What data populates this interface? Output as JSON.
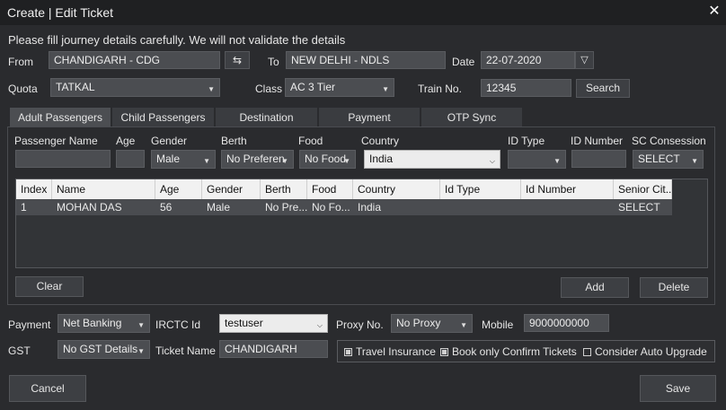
{
  "window": {
    "title": "Create | Edit Ticket"
  },
  "intro": "Please fill journey details carefully. We will not validate the details",
  "journey": {
    "from_label": "From",
    "from_value": "CHANDIGARH - CDG",
    "swap_icon": "⇆",
    "to_label": "To",
    "to_value": "NEW DELHI - NDLS",
    "date_label": "Date",
    "date_value": "22-07-2020",
    "quota_label": "Quota",
    "quota_value": "TATKAL",
    "class_label": "Class",
    "class_value": "AC 3 Tier",
    "train_label": "Train No.",
    "train_value": "12345",
    "search_label": "Search"
  },
  "tabs": [
    {
      "label": "Adult Passengers",
      "active": true
    },
    {
      "label": "Child Passengers"
    },
    {
      "label": "Destination"
    },
    {
      "label": "Payment"
    },
    {
      "label": "OTP Sync"
    }
  ],
  "adult_form": {
    "labels": {
      "name": "Passenger Name",
      "age": "Age",
      "gender": "Gender",
      "berth": "Berth",
      "food": "Food",
      "country": "Country",
      "idtype": "ID Type",
      "idnumber": "ID Number",
      "sc": "SC Consession"
    },
    "values": {
      "name": "",
      "age": "",
      "gender": "Male",
      "berth": "No Preferen",
      "food": "No Food",
      "country": "India",
      "idtype": "",
      "idnumber": "",
      "sc": "SELECT"
    }
  },
  "grid": {
    "headers": [
      "Index",
      "Name",
      "Age",
      "Gender",
      "Berth",
      "Food",
      "Country",
      "Id Type",
      "Id Number",
      "Senior Cit..."
    ],
    "rows": [
      [
        "1",
        "MOHAN DAS",
        "56",
        "Male",
        "No Pre...",
        "No Fo...",
        "India",
        "",
        "",
        "SELECT"
      ]
    ]
  },
  "buttons": {
    "clear": "Clear",
    "add": "Add",
    "delete": "Delete",
    "cancel": "Cancel",
    "save": "Save"
  },
  "bottom": {
    "payment_label": "Payment",
    "payment_value": "Net Banking",
    "irctc_label": "IRCTC Id",
    "irctc_value": "testuser",
    "proxy_label": "Proxy No.",
    "proxy_value": "No Proxy",
    "mobile_label": "Mobile",
    "mobile_value": "9000000000",
    "gst_label": "GST",
    "gst_value": "No GST Details",
    "ticketname_label": "Ticket Name",
    "ticketname_value": "CHANDIGARH",
    "travel_insurance": "Travel Insurance",
    "confirm_only": "Book only Confirm Tickets",
    "auto_upgrade": "Consider Auto Upgrade"
  },
  "colors": {
    "background": "#2a2b2e",
    "titlebar": "#1f2022",
    "field": "#4b4d51",
    "grid_header": "#f1f1f1"
  }
}
